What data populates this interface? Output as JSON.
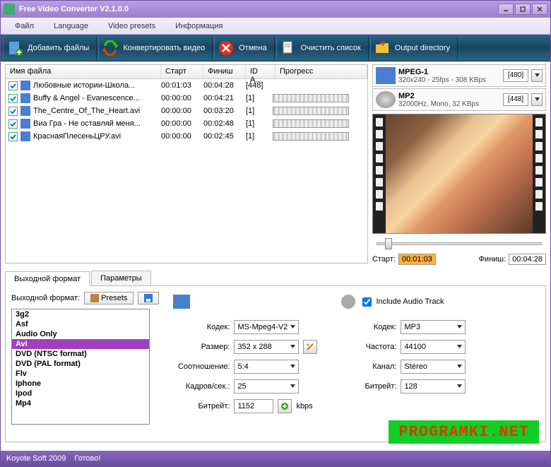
{
  "window": {
    "title": "Free Video Converter V2.1.0.0"
  },
  "menu": {
    "file": "Файл",
    "language": "Language",
    "presets": "Video presets",
    "info": "Информация"
  },
  "toolbar": {
    "add": "Добавить файлы",
    "convert": "Конвертировать видео",
    "cancel": "Отмена",
    "clear": "Очистить список",
    "output": "Output directory"
  },
  "cols": {
    "name": "Имя файла",
    "start": "Старт",
    "finish": "Финиш",
    "id": "ID A...",
    "progress": "Прогресс"
  },
  "files": [
    {
      "name": "Любовные истории-Школа...",
      "start": "00:01:03",
      "finish": "00:04:28",
      "id": "[448]",
      "complete": true
    },
    {
      "name": "Buffy & Angel - Evanescence...",
      "start": "00:00:00",
      "finish": "00:04:21",
      "id": "[1]",
      "complete": false
    },
    {
      "name": "The_Centre_Of_The_Heart.avi",
      "start": "00:00:00",
      "finish": "00:03:20",
      "id": "[1]",
      "complete": false
    },
    {
      "name": "Виа Гра - Не оставляй меня...",
      "start": "00:00:00",
      "finish": "00:02:48",
      "id": "[1]",
      "complete": false
    },
    {
      "name": "КраснаяПлесеньЦРУ.avi",
      "start": "00:00:00",
      "finish": "00:02:45",
      "id": "[1]",
      "complete": false
    }
  ],
  "presets": {
    "video": {
      "name": "MPEG-1",
      "sub": "320x240 - 25fps - 308 KBps",
      "val": "[480]"
    },
    "audio": {
      "name": "MP2",
      "sub": "32000Hz, Mono, 32 KBps",
      "val": "[448]"
    }
  },
  "time": {
    "start_label": "Старт:",
    "start": "00:01:03",
    "finish_label": "Финиш:",
    "finish": "00:04:28"
  },
  "tabs": {
    "format": "Выходной формат",
    "params": "Параметры"
  },
  "output_label": "Выходной формат:",
  "presets_btn": "Presets",
  "formats": [
    "3g2",
    "Asf",
    "Audio Only",
    "Avi",
    "DVD (NTSC format)",
    "DVD (PAL format)",
    "Flv",
    "Iphone",
    "Ipod",
    "Mp4"
  ],
  "format_sel": "Avi",
  "vparams": {
    "codec_l": "Кодек:",
    "codec": "MS-Mpeg4-V2",
    "size_l": "Размер:",
    "size": "352 x 288",
    "ratio_l": "Соотношение:",
    "ratio": "5:4",
    "fps_l": "Кадров/сек.:",
    "fps": "25",
    "bitrate_l": "Битрейт:",
    "bitrate": "1152",
    "kbps": "kbps"
  },
  "include_audio": "Include Audio Track",
  "aparams": {
    "codec_l": "Кодек:",
    "codec": "MP3",
    "freq_l": "Частота:",
    "freq": "44100",
    "chan_l": "Канал:",
    "chan": "Stéreo",
    "bitrate_l": "Битрейт:",
    "bitrate": "128"
  },
  "status": {
    "copy": "Koyote Soft 2009",
    "ready": "Готово!"
  },
  "watermark": "PROGRAMKI.NET"
}
